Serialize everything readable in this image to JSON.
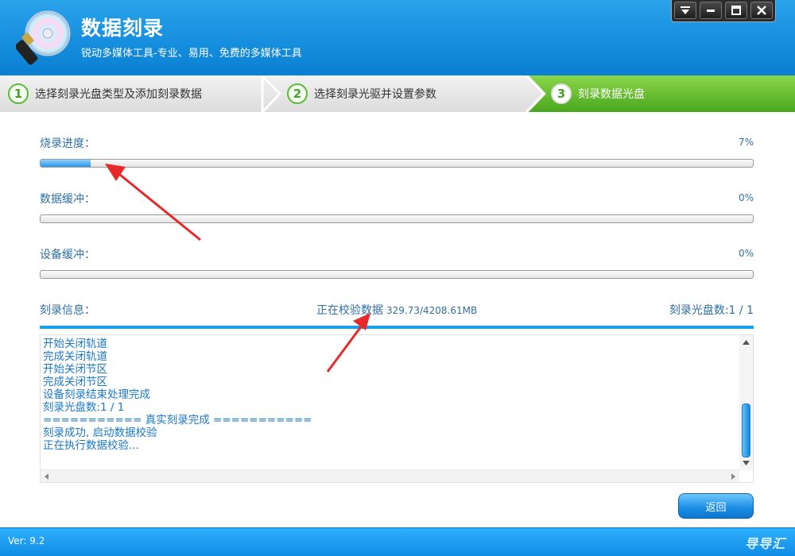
{
  "app": {
    "title": "数据刻录",
    "subtitle": "锐动多媒体工具-专业、易用、免费的多媒体工具"
  },
  "window_controls": [
    "menu-icon",
    "minimize-icon",
    "maximize-icon",
    "close-icon"
  ],
  "steps": [
    {
      "number": "1",
      "label": "选择刻录光盘类型及添加刻录数据",
      "active": false
    },
    {
      "number": "2",
      "label": "选择刻录光驱并设置参数",
      "active": false
    },
    {
      "number": "3",
      "label": "刻录数据光盘",
      "active": true
    }
  ],
  "progress": {
    "burn": {
      "label": "烧录进度：",
      "percent_text": "7%",
      "value": 0.07
    },
    "data_buffer": {
      "label": "数据缓冲：",
      "percent_text": "0%",
      "value": 0
    },
    "device_buffer": {
      "label": "设备缓冲：",
      "percent_text": "0%",
      "value": 0
    }
  },
  "info": {
    "label": "刻录信息：",
    "status_text": "正在校验数据",
    "status_mb": "329.73/4208.61MB",
    "disc_count": "刻录光盘数:1 / 1"
  },
  "log": [
    "开始关闭轨道",
    "完成关闭轨道",
    "开始关闭节区",
    "完成关闭节区",
    "设备刻录结束处理完成",
    "刻录光盘数:1 / 1",
    "=========== 真实刻录完成 ===========",
    "刻录成功, 启动数据校验",
    "正在执行数据校验..."
  ],
  "buttons": {
    "back": "返回"
  },
  "footer": {
    "version": "Ver: 9.2",
    "watermark": "导导汇"
  },
  "colors": {
    "accent_blue": "#1aa0e8",
    "step_active_green": "#5cb82e",
    "text_blue": "#2f6fa5",
    "annotation_red": "#e8292b"
  }
}
